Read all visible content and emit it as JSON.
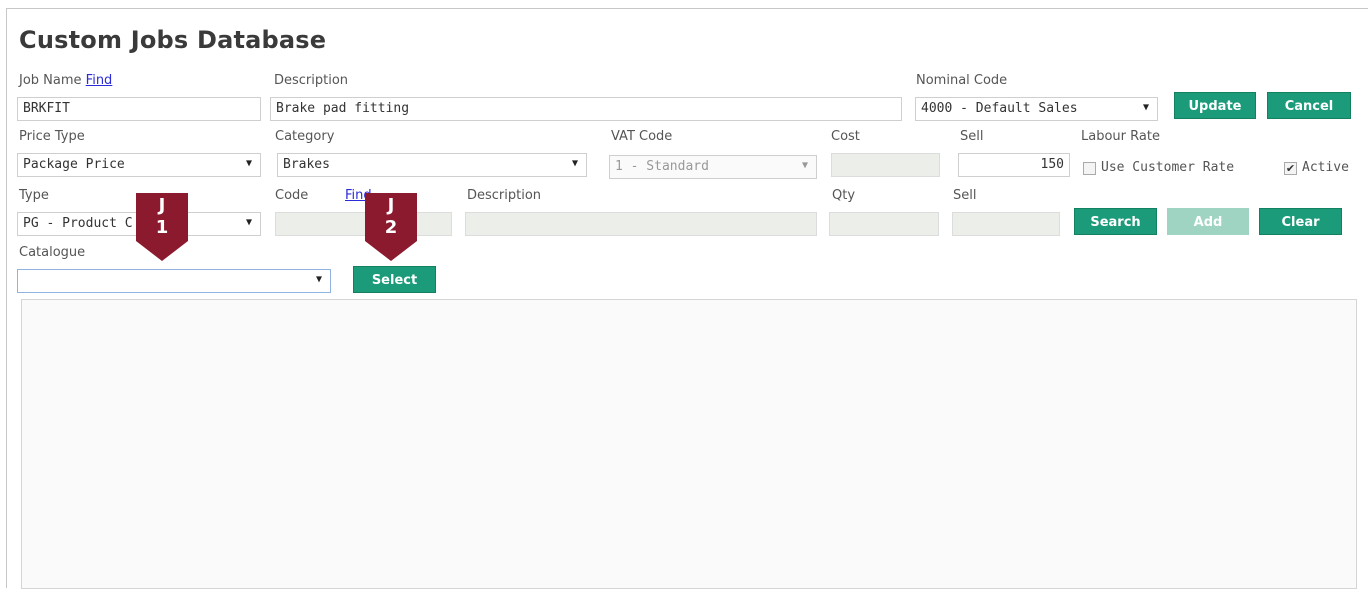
{
  "page": {
    "title": "Custom Jobs Database"
  },
  "row1": {
    "job_name_label": "Job Name",
    "find_link": "Find",
    "job_name_value": "BRKFIT",
    "description_label": "Description",
    "description_value": "Brake pad fitting",
    "nominal_code_label": "Nominal Code",
    "nominal_code_value": "4000 - Default Sales",
    "update_label": "Update",
    "cancel_label": "Cancel"
  },
  "row2": {
    "price_type_label": "Price Type",
    "price_type_value": "Package Price",
    "category_label": "Category",
    "category_value": "Brakes",
    "vat_code_label": "VAT Code",
    "vat_code_value": "1 - Standard",
    "cost_label": "Cost",
    "cost_value": "",
    "sell_label": "Sell",
    "sell_value": "150",
    "labour_rate_label": "Labour Rate",
    "use_customer_rate_label": "Use Customer Rate",
    "use_customer_rate_checked": false,
    "active_label": "Active",
    "active_checked": true
  },
  "row3": {
    "type_label": "Type",
    "type_value": "PG - Product C",
    "code_label": "Code",
    "find_link": "Find",
    "description_label": "Description",
    "qty_label": "Qty",
    "sell_label": "Sell",
    "search_label": "Search",
    "add_label": "Add",
    "clear_label": "Clear"
  },
  "row4": {
    "catalogue_label": "Catalogue",
    "catalogue_value": "",
    "select_label": "Select"
  },
  "markers": [
    {
      "line1": "J",
      "line2": "1"
    },
    {
      "line1": "J",
      "line2": "2"
    }
  ],
  "colors": {
    "button_green": "#1c9b7b",
    "marker_red": "#8b1a2e",
    "link_blue": "#2b2bd8"
  },
  "icons": {
    "dropdown": "▼",
    "check": "✔"
  }
}
